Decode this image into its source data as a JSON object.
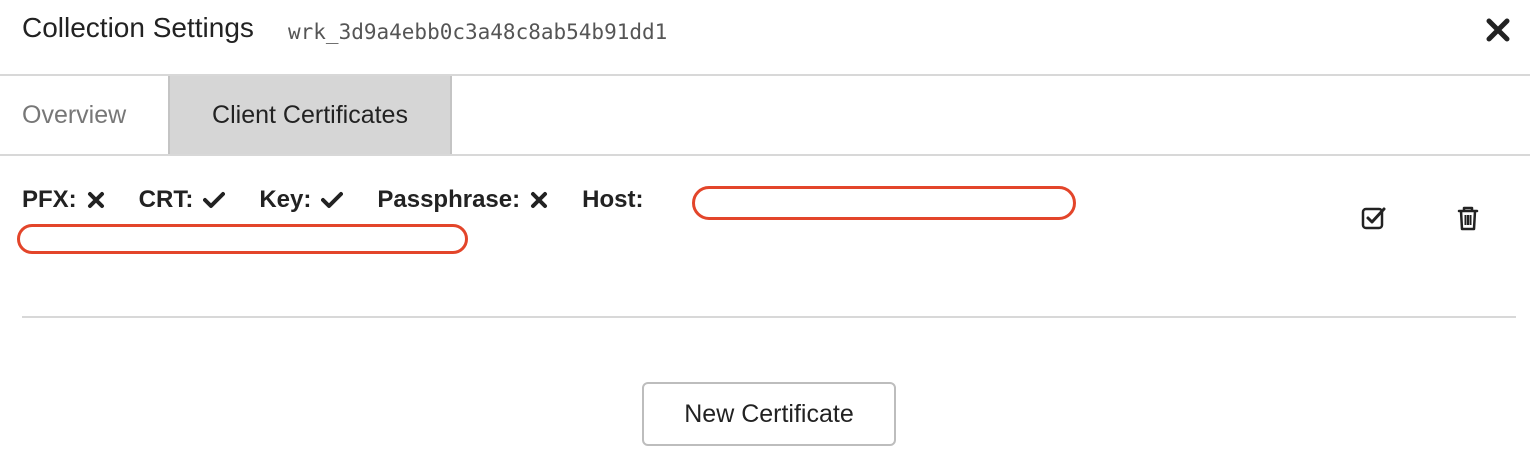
{
  "header": {
    "title": "Collection Settings",
    "workspace_id": "wrk_3d9a4ebb0c3a48c8ab54b91dd1"
  },
  "tabs": [
    {
      "label": "Overview",
      "active": false
    },
    {
      "label": "Client Certificates",
      "active": true
    }
  ],
  "certificate": {
    "pfx_label": "PFX:",
    "pfx_status": "missing",
    "crt_label": "CRT:",
    "crt_status": "present",
    "key_label": "Key:",
    "key_status": "present",
    "passphrase_label": "Passphrase:",
    "passphrase_status": "missing",
    "host_label": "Host:",
    "host_value": "",
    "enabled": true
  },
  "actions": {
    "new_certificate_label": "New Certificate"
  },
  "icons": {
    "close": "close-icon",
    "check": "check-icon",
    "cross": "cross-icon",
    "enable": "check-square-icon",
    "delete": "trash-icon"
  },
  "colors": {
    "highlight": "#e3452a",
    "active_tab": "#d6d6d6",
    "border": "#d8d8d8"
  }
}
